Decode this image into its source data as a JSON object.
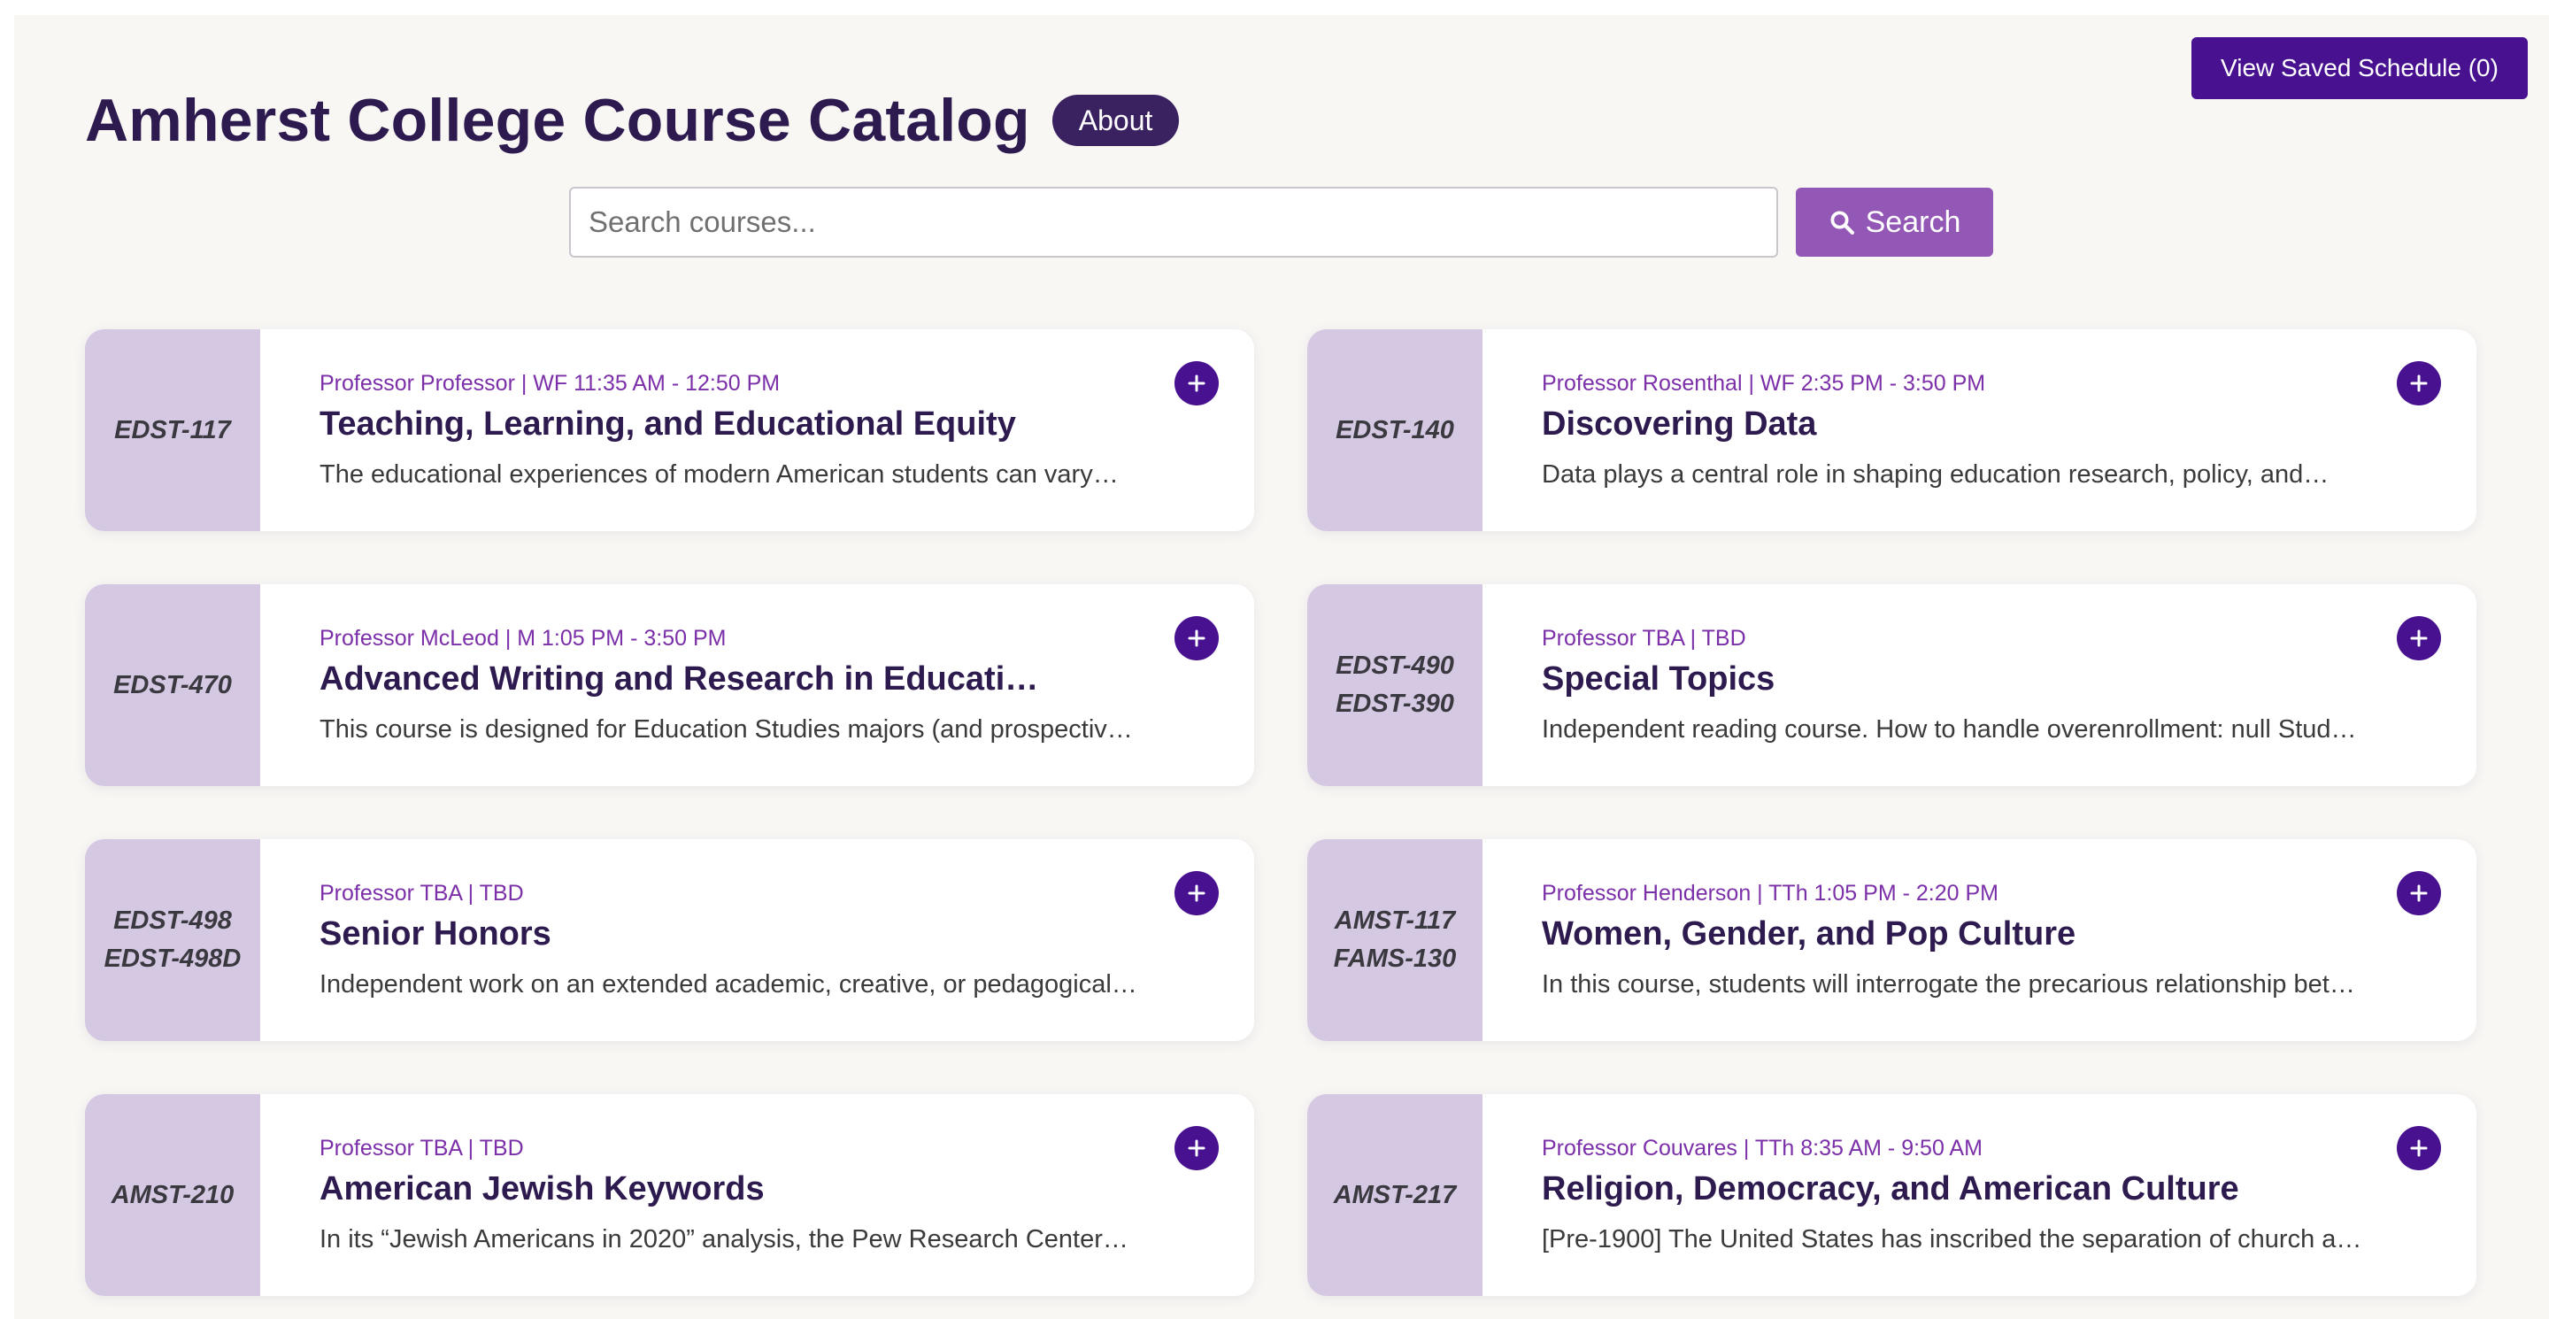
{
  "header": {
    "title": "Amherst College Course Catalog",
    "about_label": "About",
    "saved_schedule_label": "View Saved Schedule (0)"
  },
  "search": {
    "placeholder": "Search courses...",
    "value": "",
    "button_label": "Search",
    "button_icon": "search-icon"
  },
  "colors": {
    "accent_dark": "#47118f",
    "search_button": "#9358b5",
    "code_panel": "#d4c8e2",
    "meta_text": "#7b2fa8",
    "title_text": "#2d1a4f"
  },
  "add_icon": "plus-icon",
  "courses": [
    {
      "codes": [
        "EDST-117"
      ],
      "meta": "Professor Professor | WF 11:35 AM - 12:50 PM",
      "title": "Teaching, Learning, and Educational Equity",
      "description": "The educational experiences of modern American students can vary…"
    },
    {
      "codes": [
        "EDST-140"
      ],
      "meta": "Professor Rosenthal | WF 2:35 PM - 3:50 PM",
      "title": "Discovering Data",
      "description": "Data plays a central role in shaping education research, policy, and…"
    },
    {
      "codes": [
        "EDST-470"
      ],
      "meta": "Professor McLeod | M 1:05 PM - 3:50 PM",
      "title": "Advanced Writing and Research in Education…",
      "description": "This course is designed for Education Studies majors (and prospective…"
    },
    {
      "codes": [
        "EDST-490",
        "EDST-390"
      ],
      "meta": "Professor TBA | TBD",
      "title": "Special Topics",
      "description": "Independent reading course. How to handle overenrollment: null Student…"
    },
    {
      "codes": [
        "EDST-498",
        "EDST-498D"
      ],
      "meta": "Professor TBA | TBD",
      "title": "Senior Honors",
      "description": "Independent work on an extended academic, creative, or pedagogical…"
    },
    {
      "codes": [
        "AMST-117",
        "FAMS-130"
      ],
      "meta": "Professor Henderson | TTh 1:05 PM - 2:20 PM",
      "title": "Women, Gender, and Pop Culture",
      "description": "In this course, students will interrogate the precarious relationship betwe…"
    },
    {
      "codes": [
        "AMST-210"
      ],
      "meta": "Professor TBA | TBD",
      "title": "American Jewish Keywords",
      "description": "In its “Jewish Americans in 2020” analysis, the Pew Research Center…"
    },
    {
      "codes": [
        "AMST-217"
      ],
      "meta": "Professor Couvares | TTh 8:35 AM - 9:50 AM",
      "title": "Religion, Democracy, and American Culture",
      "description": "[Pre-1900] The United States has inscribed the separation of church and…"
    }
  ]
}
